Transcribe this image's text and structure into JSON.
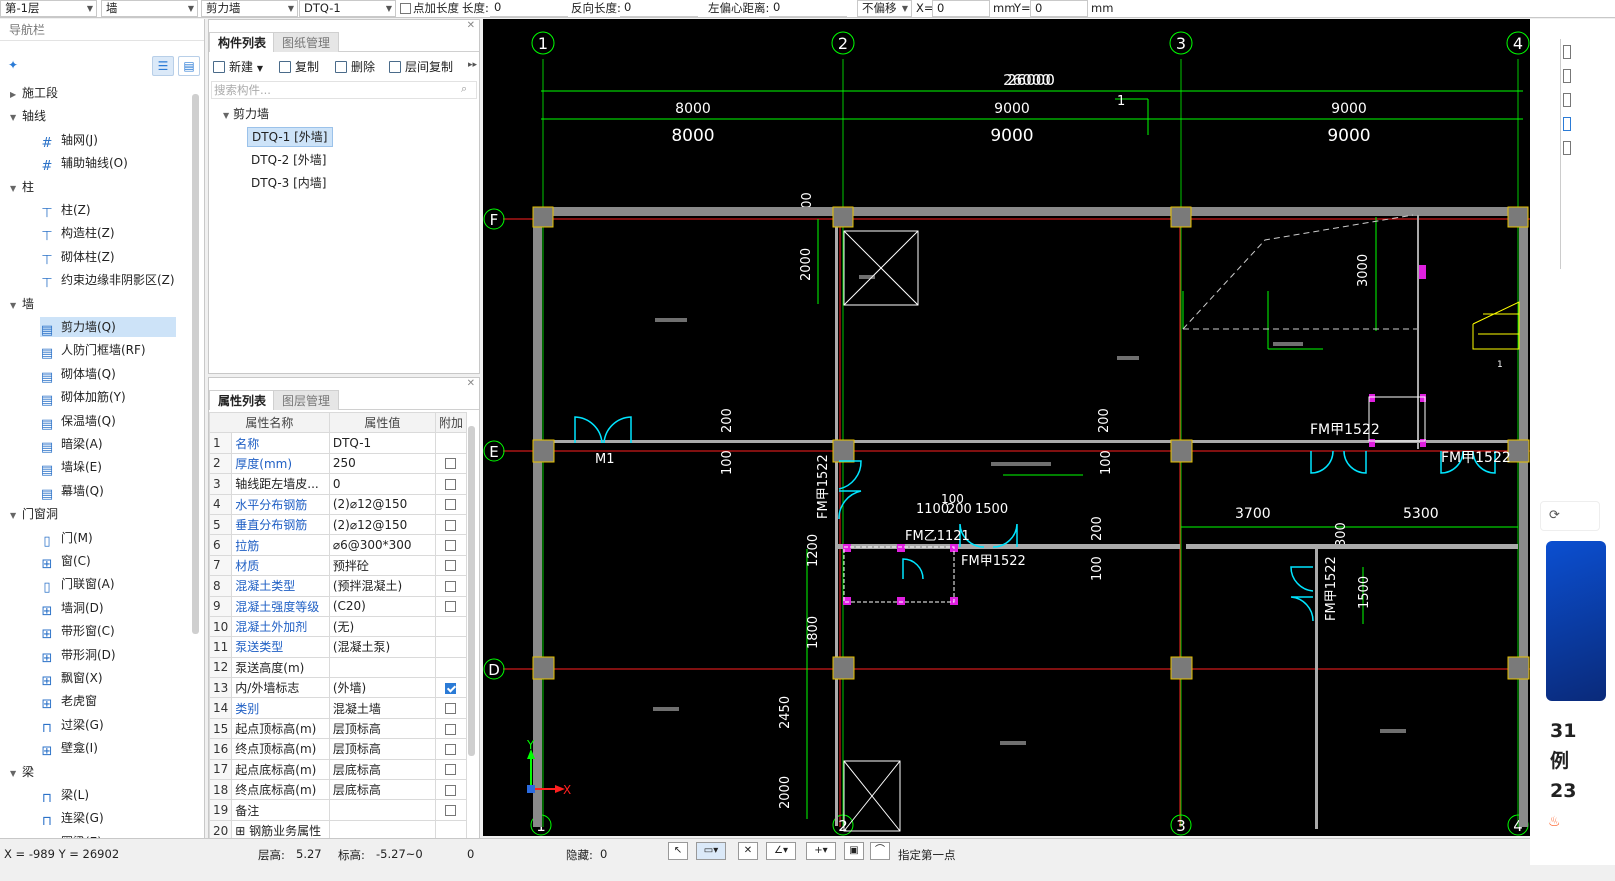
{
  "toolbar": {
    "floor": "第-1层",
    "category": "墙",
    "type": "剪力墙",
    "component": "DTQ-1",
    "extra_length_check": "点加长度",
    "length_label": "长度:",
    "length_value": "0",
    "reverse_label": "反向长度:",
    "reverse_value": "0",
    "offset_label": "左偏心距离:",
    "offset_value": "0",
    "move_mode": "不偏移",
    "x_label": "X=",
    "x_value": "0",
    "x_unit": "mm",
    "y_label": "Y=",
    "y_value": "0",
    "y_unit": "mm"
  },
  "nav": {
    "title": "导航栏",
    "groups": [
      {
        "label": "施工段",
        "items": []
      },
      {
        "label": "轴线",
        "items": [
          {
            "label": "轴网(J)",
            "icon": "grid-icon"
          },
          {
            "label": "辅助轴线(O)",
            "icon": "grid-icon"
          }
        ]
      },
      {
        "label": "柱",
        "items": [
          {
            "label": "柱(Z)",
            "icon": "column-icon"
          },
          {
            "label": "构造柱(Z)",
            "icon": "column-icon"
          },
          {
            "label": "砌体柱(Z)",
            "icon": "column-icon"
          },
          {
            "label": "约束边缘非阴影区(Z)",
            "icon": "column-icon"
          }
        ]
      },
      {
        "label": "墙",
        "items": [
          {
            "label": "剪力墙(Q)",
            "icon": "wall-icon"
          },
          {
            "label": "人防门框墙(RF)",
            "icon": "wall-icon"
          },
          {
            "label": "砌体墙(Q)",
            "icon": "wall-icon"
          },
          {
            "label": "砌体加筋(Y)",
            "icon": "wall-icon"
          },
          {
            "label": "保温墙(Q)",
            "icon": "wall-icon"
          },
          {
            "label": "暗梁(A)",
            "icon": "wall-icon"
          },
          {
            "label": "墙垛(E)",
            "icon": "wall-icon"
          },
          {
            "label": "幕墙(Q)",
            "icon": "wall-icon"
          }
        ]
      },
      {
        "label": "门窗洞",
        "items": [
          {
            "label": "门(M)",
            "icon": "door-icon"
          },
          {
            "label": "窗(C)",
            "icon": "window-icon"
          },
          {
            "label": "门联窗(A)",
            "icon": "door-icon"
          },
          {
            "label": "墙洞(D)",
            "icon": "window-icon"
          },
          {
            "label": "带形窗(C)",
            "icon": "window-icon"
          },
          {
            "label": "带形洞(D)",
            "icon": "window-icon"
          },
          {
            "label": "飘窗(X)",
            "icon": "window-icon"
          },
          {
            "label": "老虎窗",
            "icon": "window-icon"
          },
          {
            "label": "过梁(G)",
            "icon": "beam-icon"
          },
          {
            "label": "壁龛(I)",
            "icon": "window-icon"
          }
        ]
      },
      {
        "label": "梁",
        "items": [
          {
            "label": "梁(L)",
            "icon": "beam-icon"
          },
          {
            "label": "连梁(G)",
            "icon": "beam-icon"
          },
          {
            "label": "圈梁(E)",
            "icon": "beam-icon"
          }
        ]
      }
    ]
  },
  "comp": {
    "tabs": [
      "构件列表",
      "图纸管理"
    ],
    "buttons": [
      "新建",
      "复制",
      "删除",
      "层间复制"
    ],
    "search_placeholder": "搜索构件...",
    "tree_root": "剪力墙",
    "tree_items": [
      "DTQ-1 [外墙]",
      "DTQ-2 [外墙]",
      "DTQ-3 [内墙]"
    ]
  },
  "props": {
    "tabs": [
      "属性列表",
      "图层管理"
    ],
    "headers": [
      "属性名称",
      "属性值",
      "附加"
    ],
    "rows": [
      {
        "n": "1",
        "k": "名称",
        "v": "DTQ-1",
        "blue": true,
        "chk": "none"
      },
      {
        "n": "2",
        "k": "厚度(mm)",
        "v": "250",
        "blue": true,
        "chk": "off"
      },
      {
        "n": "3",
        "k": "轴线距左墙皮...",
        "v": "0",
        "blue": false,
        "chk": "off"
      },
      {
        "n": "4",
        "k": "水平分布钢筋",
        "v": "(2)⌀12@150",
        "blue": true,
        "chk": "off"
      },
      {
        "n": "5",
        "k": "垂直分布钢筋",
        "v": "(2)⌀12@150",
        "blue": true,
        "chk": "off"
      },
      {
        "n": "6",
        "k": "拉筋",
        "v": "⌀6@300*300",
        "blue": true,
        "chk": "off"
      },
      {
        "n": "7",
        "k": "材质",
        "v": "预拌砼",
        "blue": true,
        "chk": "off"
      },
      {
        "n": "8",
        "k": "混凝土类型",
        "v": "(预拌混凝土)",
        "blue": true,
        "chk": "off"
      },
      {
        "n": "9",
        "k": "混凝土强度等级",
        "v": "(C20)",
        "blue": true,
        "chk": "off"
      },
      {
        "n": "10",
        "k": "混凝土外加剂",
        "v": "(无)",
        "blue": true,
        "chk": "none"
      },
      {
        "n": "11",
        "k": "泵送类型",
        "v": "(混凝土泵)",
        "blue": true,
        "chk": "none"
      },
      {
        "n": "12",
        "k": "泵送高度(m)",
        "v": "",
        "blue": false,
        "chk": "none"
      },
      {
        "n": "13",
        "k": "内/外墙标志",
        "v": "(外墙)",
        "blue": false,
        "chk": "on"
      },
      {
        "n": "14",
        "k": "类别",
        "v": "混凝土墙",
        "blue": true,
        "chk": "off"
      },
      {
        "n": "15",
        "k": "起点顶标高(m)",
        "v": "层顶标高",
        "blue": false,
        "chk": "off"
      },
      {
        "n": "16",
        "k": "终点顶标高(m)",
        "v": "层顶标高",
        "blue": false,
        "chk": "off"
      },
      {
        "n": "17",
        "k": "起点底标高(m)",
        "v": "层底标高",
        "blue": false,
        "chk": "off"
      },
      {
        "n": "18",
        "k": "终点底标高(m)",
        "v": "层底标高",
        "blue": false,
        "chk": "off"
      },
      {
        "n": "19",
        "k": "备注",
        "v": "",
        "blue": false,
        "chk": "off"
      },
      {
        "n": "20",
        "k": "⊞ 钢筋业务属性",
        "v": "",
        "blue": false,
        "chk": "none"
      }
    ]
  },
  "cad": {
    "axes_top": [
      "1",
      "2",
      "3",
      "4"
    ],
    "axes_left": [
      "F",
      "E",
      "D"
    ],
    "dim_total": "26000",
    "dim_total_overlap": "26000",
    "dim_spans": [
      "8000",
      "9000",
      "9000"
    ],
    "dims_misc": [
      "300",
      "2000",
      "3000",
      "200",
      "100",
      "200",
      "100",
      "1100",
      "200",
      "1500",
      "100",
      "3700",
      "5300",
      "200",
      "100",
      "300",
      "1200",
      "1500",
      "1800",
      "2450",
      "2000"
    ],
    "doors": [
      "M1",
      "FM甲1522",
      "FM甲1522",
      "FM甲1522",
      "FM乙1121",
      "FM甲1522",
      "FM甲1522"
    ],
    "marker_1": "1",
    "marker_1b": "1",
    "ucs_x": "X",
    "ucs_y": "Y",
    "colors": {
      "axis": "#00ff00",
      "wall": "#9a9a9a",
      "red": "#ff2020",
      "cyan": "#00e5ff",
      "magenta": "#e020e0",
      "yellow": "#ffff00",
      "col": "#7a7a7a"
    }
  },
  "right_strip": {
    "lines": [
      "31",
      "例",
      "23"
    ]
  },
  "status": {
    "coord": "X = -989 Y = 26902",
    "floor_h_label": "层高:",
    "floor_h": "5.27",
    "elev_label": "标高:",
    "elev": "-5.27~0",
    "count": "0",
    "hidden_label": "隐藏:",
    "hidden": "0",
    "prompt": "指定第一点"
  }
}
